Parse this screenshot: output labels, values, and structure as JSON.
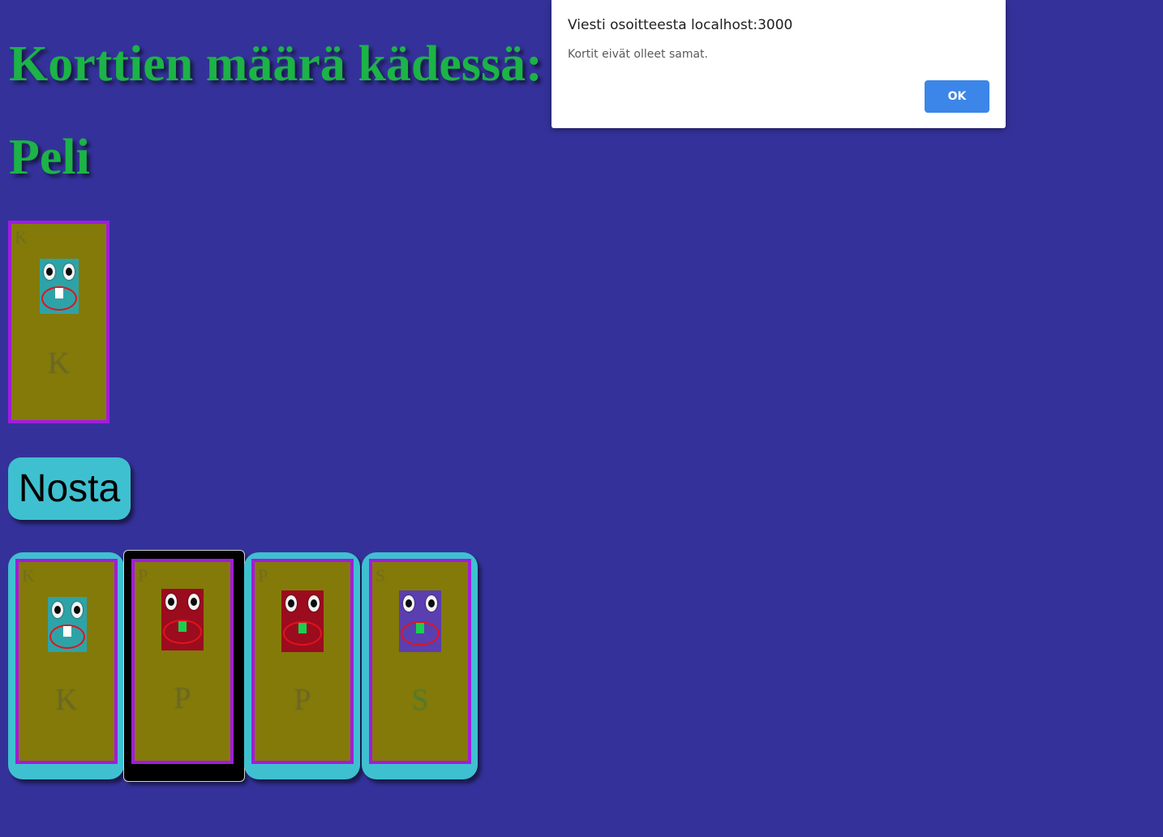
{
  "heading_count": "Korttien määrä kädessä:",
  "heading_game": "Peli",
  "draw_button": "Nosta",
  "dialog": {
    "title": "Viesti osoitteesta localhost:3000",
    "message": "Kortit eivät olleet samat.",
    "ok_label": "OK"
  },
  "colors": {
    "background": "#34329a",
    "heading": "#1cb347",
    "card_fill": "#837a0a",
    "card_border": "#a21be0",
    "slot": "#3fc0d0",
    "dialog_button": "#3b86e8"
  },
  "table_card": {
    "letter": "K",
    "face_color": "#2ea3a7",
    "tooth_color": "#ffffff"
  },
  "hand": [
    {
      "letter": "K",
      "face_color": "#2ea3a7",
      "tooth_color": "#ffffff",
      "selected": false
    },
    {
      "letter": "P",
      "face_color": "#9b0c1e",
      "tooth_color": "#19d04e",
      "selected": true
    },
    {
      "letter": "P",
      "face_color": "#9b0c1e",
      "tooth_color": "#19d04e",
      "selected": false
    },
    {
      "letter": "S",
      "face_color": "#5b3fb0",
      "tooth_color": "#19d04e",
      "selected": false
    }
  ]
}
